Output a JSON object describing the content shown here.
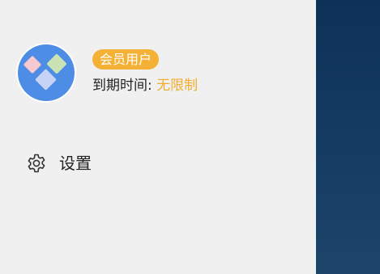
{
  "profile": {
    "avatar_icon": "diamond-tiles-icon",
    "badge_label": "会员用户",
    "expiry_label": "到期时间: ",
    "expiry_value": "无限制"
  },
  "menu": {
    "settings_label": "设置",
    "settings_icon": "gear-icon"
  },
  "colors": {
    "drawer_background": "#f0f0f0",
    "avatar_blue": "#4e8de5",
    "badge_orange": "#f4b136",
    "expiry_value_orange": "#f0ad2f",
    "backdrop_navy": "#0f2d4d"
  }
}
